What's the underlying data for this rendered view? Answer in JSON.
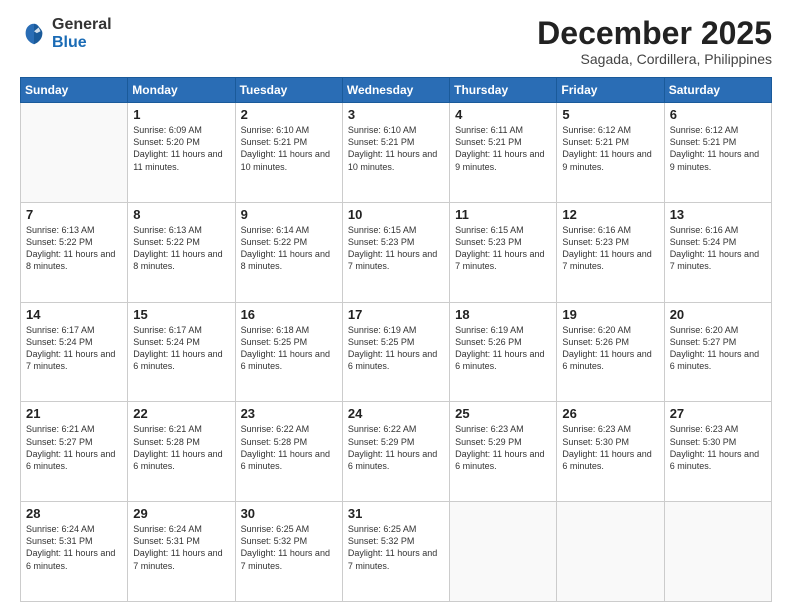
{
  "logo": {
    "general": "General",
    "blue": "Blue"
  },
  "header": {
    "month": "December 2025",
    "location": "Sagada, Cordillera, Philippines"
  },
  "days": [
    "Sunday",
    "Monday",
    "Tuesday",
    "Wednesday",
    "Thursday",
    "Friday",
    "Saturday"
  ],
  "weeks": [
    [
      {
        "day": "",
        "sunrise": "",
        "sunset": "",
        "daylight": ""
      },
      {
        "day": "1",
        "sunrise": "Sunrise: 6:09 AM",
        "sunset": "Sunset: 5:20 PM",
        "daylight": "Daylight: 11 hours and 11 minutes."
      },
      {
        "day": "2",
        "sunrise": "Sunrise: 6:10 AM",
        "sunset": "Sunset: 5:21 PM",
        "daylight": "Daylight: 11 hours and 10 minutes."
      },
      {
        "day": "3",
        "sunrise": "Sunrise: 6:10 AM",
        "sunset": "Sunset: 5:21 PM",
        "daylight": "Daylight: 11 hours and 10 minutes."
      },
      {
        "day": "4",
        "sunrise": "Sunrise: 6:11 AM",
        "sunset": "Sunset: 5:21 PM",
        "daylight": "Daylight: 11 hours and 9 minutes."
      },
      {
        "day": "5",
        "sunrise": "Sunrise: 6:12 AM",
        "sunset": "Sunset: 5:21 PM",
        "daylight": "Daylight: 11 hours and 9 minutes."
      },
      {
        "day": "6",
        "sunrise": "Sunrise: 6:12 AM",
        "sunset": "Sunset: 5:21 PM",
        "daylight": "Daylight: 11 hours and 9 minutes."
      }
    ],
    [
      {
        "day": "7",
        "sunrise": "Sunrise: 6:13 AM",
        "sunset": "Sunset: 5:22 PM",
        "daylight": "Daylight: 11 hours and 8 minutes."
      },
      {
        "day": "8",
        "sunrise": "Sunrise: 6:13 AM",
        "sunset": "Sunset: 5:22 PM",
        "daylight": "Daylight: 11 hours and 8 minutes."
      },
      {
        "day": "9",
        "sunrise": "Sunrise: 6:14 AM",
        "sunset": "Sunset: 5:22 PM",
        "daylight": "Daylight: 11 hours and 8 minutes."
      },
      {
        "day": "10",
        "sunrise": "Sunrise: 6:15 AM",
        "sunset": "Sunset: 5:23 PM",
        "daylight": "Daylight: 11 hours and 7 minutes."
      },
      {
        "day": "11",
        "sunrise": "Sunrise: 6:15 AM",
        "sunset": "Sunset: 5:23 PM",
        "daylight": "Daylight: 11 hours and 7 minutes."
      },
      {
        "day": "12",
        "sunrise": "Sunrise: 6:16 AM",
        "sunset": "Sunset: 5:23 PM",
        "daylight": "Daylight: 11 hours and 7 minutes."
      },
      {
        "day": "13",
        "sunrise": "Sunrise: 6:16 AM",
        "sunset": "Sunset: 5:24 PM",
        "daylight": "Daylight: 11 hours and 7 minutes."
      }
    ],
    [
      {
        "day": "14",
        "sunrise": "Sunrise: 6:17 AM",
        "sunset": "Sunset: 5:24 PM",
        "daylight": "Daylight: 11 hours and 7 minutes."
      },
      {
        "day": "15",
        "sunrise": "Sunrise: 6:17 AM",
        "sunset": "Sunset: 5:24 PM",
        "daylight": "Daylight: 11 hours and 6 minutes."
      },
      {
        "day": "16",
        "sunrise": "Sunrise: 6:18 AM",
        "sunset": "Sunset: 5:25 PM",
        "daylight": "Daylight: 11 hours and 6 minutes."
      },
      {
        "day": "17",
        "sunrise": "Sunrise: 6:19 AM",
        "sunset": "Sunset: 5:25 PM",
        "daylight": "Daylight: 11 hours and 6 minutes."
      },
      {
        "day": "18",
        "sunrise": "Sunrise: 6:19 AM",
        "sunset": "Sunset: 5:26 PM",
        "daylight": "Daylight: 11 hours and 6 minutes."
      },
      {
        "day": "19",
        "sunrise": "Sunrise: 6:20 AM",
        "sunset": "Sunset: 5:26 PM",
        "daylight": "Daylight: 11 hours and 6 minutes."
      },
      {
        "day": "20",
        "sunrise": "Sunrise: 6:20 AM",
        "sunset": "Sunset: 5:27 PM",
        "daylight": "Daylight: 11 hours and 6 minutes."
      }
    ],
    [
      {
        "day": "21",
        "sunrise": "Sunrise: 6:21 AM",
        "sunset": "Sunset: 5:27 PM",
        "daylight": "Daylight: 11 hours and 6 minutes."
      },
      {
        "day": "22",
        "sunrise": "Sunrise: 6:21 AM",
        "sunset": "Sunset: 5:28 PM",
        "daylight": "Daylight: 11 hours and 6 minutes."
      },
      {
        "day": "23",
        "sunrise": "Sunrise: 6:22 AM",
        "sunset": "Sunset: 5:28 PM",
        "daylight": "Daylight: 11 hours and 6 minutes."
      },
      {
        "day": "24",
        "sunrise": "Sunrise: 6:22 AM",
        "sunset": "Sunset: 5:29 PM",
        "daylight": "Daylight: 11 hours and 6 minutes."
      },
      {
        "day": "25",
        "sunrise": "Sunrise: 6:23 AM",
        "sunset": "Sunset: 5:29 PM",
        "daylight": "Daylight: 11 hours and 6 minutes."
      },
      {
        "day": "26",
        "sunrise": "Sunrise: 6:23 AM",
        "sunset": "Sunset: 5:30 PM",
        "daylight": "Daylight: 11 hours and 6 minutes."
      },
      {
        "day": "27",
        "sunrise": "Sunrise: 6:23 AM",
        "sunset": "Sunset: 5:30 PM",
        "daylight": "Daylight: 11 hours and 6 minutes."
      }
    ],
    [
      {
        "day": "28",
        "sunrise": "Sunrise: 6:24 AM",
        "sunset": "Sunset: 5:31 PM",
        "daylight": "Daylight: 11 hours and 6 minutes."
      },
      {
        "day": "29",
        "sunrise": "Sunrise: 6:24 AM",
        "sunset": "Sunset: 5:31 PM",
        "daylight": "Daylight: 11 hours and 7 minutes."
      },
      {
        "day": "30",
        "sunrise": "Sunrise: 6:25 AM",
        "sunset": "Sunset: 5:32 PM",
        "daylight": "Daylight: 11 hours and 7 minutes."
      },
      {
        "day": "31",
        "sunrise": "Sunrise: 6:25 AM",
        "sunset": "Sunset: 5:32 PM",
        "daylight": "Daylight: 11 hours and 7 minutes."
      },
      {
        "day": "",
        "sunrise": "",
        "sunset": "",
        "daylight": ""
      },
      {
        "day": "",
        "sunrise": "",
        "sunset": "",
        "daylight": ""
      },
      {
        "day": "",
        "sunrise": "",
        "sunset": "",
        "daylight": ""
      }
    ]
  ]
}
